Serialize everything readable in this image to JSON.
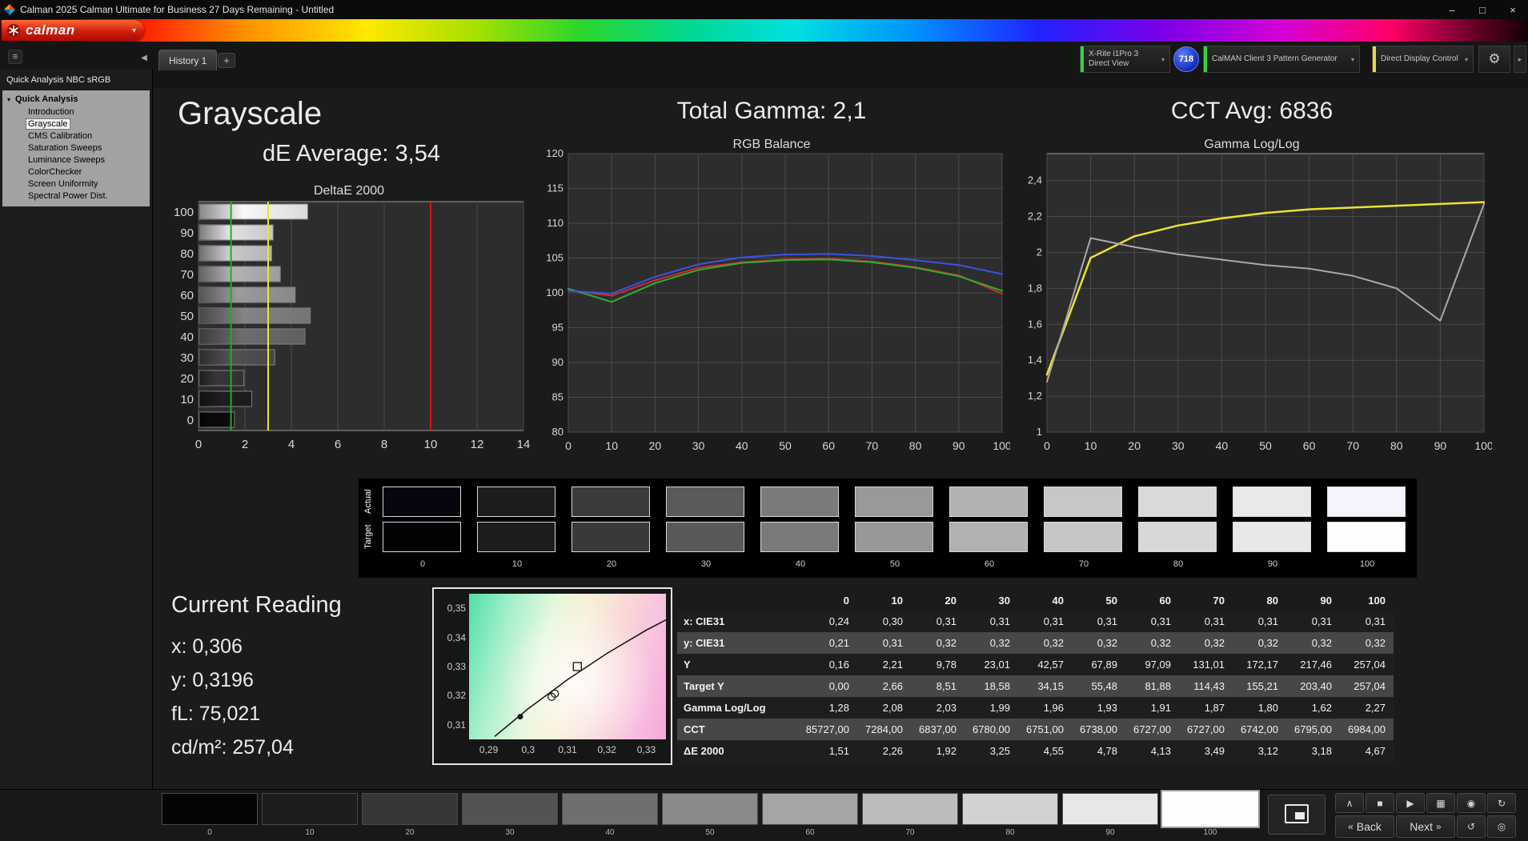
{
  "window": {
    "title": "Calman 2025 Calman Ultimate for Business 27 Days Remaining  - Untitled"
  },
  "icons": {
    "logo_chevron": "▾",
    "menu": "≡",
    "collapse_left": "◀",
    "add_tab": "+",
    "chevron_down": "▾",
    "gear": "⚙",
    "more_right": "▸",
    "expander": "▾",
    "minimize": "–",
    "maximize": "□",
    "close": "×",
    "chevron_up": "∧",
    "stop": "■",
    "play": "▶",
    "save": "▦",
    "record": "◉",
    "refresh": "↻",
    "back_arrows": "«",
    "next_arrows": "»",
    "sync": "↺",
    "power": "◎"
  },
  "brand": {
    "logo": "calman"
  },
  "tabbar": {
    "tab": "History 1"
  },
  "devices": {
    "meter_line1": "X-Rite i1Pro 3",
    "meter_line2": "Direct View",
    "meter_accent": "#35d43a",
    "badge": "718",
    "pattern_gen": "CalMAN Client 3 Pattern Generator",
    "pattern_accent": "#35d43a",
    "display_ctrl": "Direct Display Control",
    "display_accent": "#e3df36"
  },
  "sidebar": {
    "workflow": "Quick Analysis NBC sRGB",
    "root": "Quick Analysis",
    "items": [
      "Introduction",
      "Grayscale",
      "CMS Calibration",
      "Saturation Sweeps",
      "Luminance Sweeps",
      "ColorChecker",
      "Screen Uniformity",
      "Spectral Power Dist."
    ],
    "selected": "Grayscale"
  },
  "headers": {
    "grayscale_title": "Grayscale",
    "de_average": "dE Average: 3,54",
    "gamma_title": "Total Gamma: 2,1",
    "cct_title": "CCT Avg: 6836"
  },
  "chart_data": [
    {
      "type": "bar",
      "title": "DeltaE 2000",
      "orientation": "horizontal",
      "categories": [
        "100",
        "90",
        "80",
        "70",
        "60",
        "50",
        "40",
        "30",
        "20",
        "10",
        "0"
      ],
      "values": [
        4.67,
        3.18,
        3.12,
        3.49,
        4.13,
        4.78,
        4.55,
        3.25,
        1.92,
        2.26,
        1.51
      ],
      "bar_colors": [
        "#f8f8f8",
        "#e2e2e2",
        "#cbcbcb",
        "#b3b3b3",
        "#9b9b9b",
        "#848484",
        "#6c6c6c",
        "#515151",
        "#373737",
        "#1e1e1e",
        "#0a0a0a"
      ],
      "xlim": [
        0,
        14
      ],
      "xticks": [
        0,
        2,
        4,
        6,
        8,
        10,
        12,
        14
      ],
      "reference_lines": [
        {
          "x": 1.4,
          "color": "#1faf1f"
        },
        {
          "x": 3.0,
          "color": "#e6e62e"
        },
        {
          "x": 10.0,
          "color": "#dd1111"
        }
      ]
    },
    {
      "type": "line",
      "title": "RGB Balance",
      "x": [
        0,
        10,
        20,
        30,
        40,
        50,
        60,
        70,
        80,
        90,
        100
      ],
      "xlim": [
        0,
        100
      ],
      "ylim": [
        80,
        120
      ],
      "yticks": [
        120,
        115,
        110,
        105,
        100,
        95,
        90,
        85,
        80
      ],
      "xticks": [
        0,
        10,
        20,
        30,
        40,
        50,
        60,
        70,
        80,
        90,
        100
      ],
      "series": [
        {
          "name": "Red",
          "color": "#d22d2d",
          "values": [
            100.4,
            99.6,
            101.8,
            103.6,
            104.4,
            104.8,
            104.9,
            104.5,
            103.7,
            102.5,
            99.9
          ]
        },
        {
          "name": "Green",
          "color": "#2fae2f",
          "values": [
            100.6,
            98.7,
            101.4,
            103.3,
            104.3,
            104.7,
            104.8,
            104.4,
            103.6,
            102.4,
            100.3
          ]
        },
        {
          "name": "Blue",
          "color": "#3c52e8",
          "values": [
            100.3,
            99.9,
            102.3,
            104.1,
            105.1,
            105.5,
            105.6,
            105.3,
            104.7,
            104.0,
            102.7
          ]
        }
      ]
    },
    {
      "type": "line",
      "title": "Gamma Log/Log",
      "x": [
        0,
        10,
        20,
        30,
        40,
        50,
        60,
        70,
        80,
        90,
        100
      ],
      "xlim": [
        0,
        100
      ],
      "ylim": [
        1,
        2.55
      ],
      "yticks": [
        2.4,
        2.2,
        2.0,
        1.8,
        1.6,
        1.4,
        1.2,
        1.0
      ],
      "ytick_labels": [
        "2,4",
        "2,2",
        "2",
        "1,8",
        "1,6",
        "1,4",
        "1,2",
        "1"
      ],
      "xticks": [
        0,
        10,
        20,
        30,
        40,
        50,
        60,
        70,
        80,
        90,
        100
      ],
      "series": [
        {
          "name": "Target Gamma",
          "color": "#ece32c",
          "width": 2.5,
          "values": [
            1.32,
            1.97,
            2.09,
            2.15,
            2.19,
            2.22,
            2.24,
            2.25,
            2.26,
            2.27,
            2.28
          ]
        },
        {
          "name": "Measured Gamma",
          "color": "#a9a9a9",
          "width": 2,
          "values": [
            1.28,
            2.08,
            2.03,
            1.99,
            1.96,
            1.93,
            1.91,
            1.87,
            1.8,
            1.62,
            2.27
          ]
        }
      ]
    }
  ],
  "swatches": {
    "row_labels": [
      "Actual",
      "Target"
    ],
    "column_labels": [
      "0",
      "10",
      "20",
      "30",
      "40",
      "50",
      "60",
      "70",
      "80",
      "90",
      "100"
    ],
    "actual": [
      "#06060e",
      "#1d1d1f",
      "#3a3a3c",
      "#5a5a5c",
      "#7b7b7d",
      "#99999b",
      "#b2b2b4",
      "#c7c7c9",
      "#d9d9db",
      "#e9e9eb",
      "#f5f3fc"
    ],
    "target": [
      "#020204",
      "#1c1c1e",
      "#39393b",
      "#59595b",
      "#7a7a7c",
      "#98989a",
      "#b1b1b3",
      "#c6c6c8",
      "#d8d8da",
      "#e8e8ea",
      "#fdfdfd"
    ]
  },
  "current_reading": {
    "title": "Current Reading",
    "x": "x: 0,306",
    "y": "y: 0,3196",
    "fl": "fL: 75,021",
    "cdm2": "cd/m²: 257,04"
  },
  "cie": {
    "xlim": [
      0.285,
      0.335
    ],
    "ylim": [
      0.305,
      0.355
    ],
    "xticks": [
      "0,29",
      "0,3",
      "0,31",
      "0,32",
      "0,33"
    ],
    "yticks": [
      "0,35",
      "0,34",
      "0,33",
      "0,32",
      "0,31"
    ],
    "locus": [
      [
        0.2915,
        0.306
      ],
      [
        0.3,
        0.3155
      ],
      [
        0.31,
        0.3255
      ],
      [
        0.32,
        0.3345
      ],
      [
        0.33,
        0.3425
      ],
      [
        0.335,
        0.346
      ]
    ],
    "markers": [
      {
        "type": "square",
        "x": 0.3125,
        "y": 0.33
      },
      {
        "type": "circle",
        "x": 0.3068,
        "y": 0.3207
      },
      {
        "type": "circle",
        "x": 0.306,
        "y": 0.3196
      },
      {
        "type": "dot",
        "x": 0.298,
        "y": 0.3128
      }
    ]
  },
  "table": {
    "columns": [
      "",
      "0",
      "10",
      "20",
      "30",
      "40",
      "50",
      "60",
      "70",
      "80",
      "90",
      "100"
    ],
    "rows": [
      {
        "label": "x: CIE31",
        "values": [
          "0,24",
          "0,30",
          "0,31",
          "0,31",
          "0,31",
          "0,31",
          "0,31",
          "0,31",
          "0,31",
          "0,31",
          "0,31"
        ]
      },
      {
        "label": "y: CIE31",
        "values": [
          "0,21",
          "0,31",
          "0,32",
          "0,32",
          "0,32",
          "0,32",
          "0,32",
          "0,32",
          "0,32",
          "0,32",
          "0,32"
        ]
      },
      {
        "label": "Y",
        "values": [
          "0,16",
          "2,21",
          "9,78",
          "23,01",
          "42,57",
          "67,89",
          "97,09",
          "131,01",
          "172,17",
          "217,46",
          "257,04"
        ]
      },
      {
        "label": "Target Y",
        "values": [
          "0,00",
          "2,66",
          "8,51",
          "18,58",
          "34,15",
          "55,48",
          "81,88",
          "114,43",
          "155,21",
          "203,40",
          "257,04"
        ]
      },
      {
        "label": "Gamma Log/Log",
        "values": [
          "1,28",
          "2,08",
          "2,03",
          "1,99",
          "1,96",
          "1,93",
          "1,91",
          "1,87",
          "1,80",
          "1,62",
          "2,27"
        ]
      },
      {
        "label": "CCT",
        "values": [
          "85727,00",
          "7284,00",
          "6837,00",
          "6780,00",
          "6751,00",
          "6738,00",
          "6727,00",
          "6727,00",
          "6742,00",
          "6795,00",
          "6984,00"
        ]
      },
      {
        "label": "ΔE 2000",
        "values": [
          "1,51",
          "2,26",
          "1,92",
          "3,25",
          "4,55",
          "4,78",
          "4,13",
          "3,49",
          "3,12",
          "3,18",
          "4,67"
        ]
      }
    ]
  },
  "toolbar": {
    "back": "Back",
    "next": "Next",
    "patches": [
      {
        "label": "0",
        "color": "#050505"
      },
      {
        "label": "10",
        "color": "#1c1c1c"
      },
      {
        "label": "20",
        "color": "#373737"
      },
      {
        "label": "30",
        "color": "#535353"
      },
      {
        "label": "40",
        "color": "#6f6f6f"
      },
      {
        "label": "50",
        "color": "#8a8a8a"
      },
      {
        "label": "60",
        "color": "#a5a5a5"
      },
      {
        "label": "70",
        "color": "#bcbcbc"
      },
      {
        "label": "80",
        "color": "#d2d2d2"
      },
      {
        "label": "90",
        "color": "#e7e7e7"
      },
      {
        "label": "100",
        "color": "#fdfdfd",
        "selected": true
      }
    ]
  }
}
